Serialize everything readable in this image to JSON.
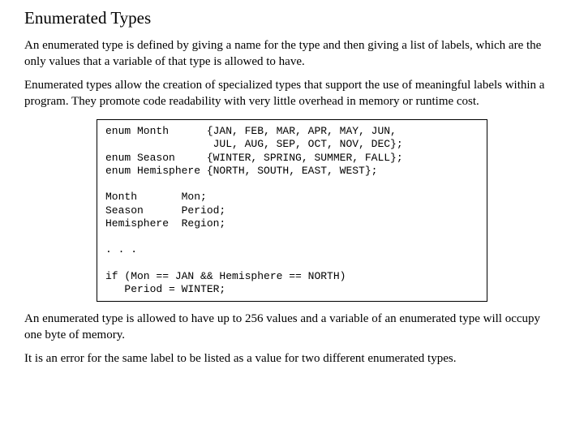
{
  "title": "Enumerated Types",
  "para1": "An enumerated type is defined by giving a name for the type and then giving a list of labels, which are the only values that a variable of that type is allowed to have.",
  "para2": "Enumerated types allow the creation of specialized types that support the use of meaningful labels within a program.  They promote code readability with very little overhead in memory or runtime cost.",
  "code": "enum Month      {JAN, FEB, MAR, APR, MAY, JUN,\n                 JUL, AUG, SEP, OCT, NOV, DEC};\nenum Season     {WINTER, SPRING, SUMMER, FALL};\nenum Hemisphere {NORTH, SOUTH, EAST, WEST};\n\nMonth       Mon;\nSeason      Period;\nHemisphere  Region;\n\n. . .\n\nif (Mon == JAN && Hemisphere == NORTH)\n   Period = WINTER;",
  "para3": "An enumerated type is allowed to have up to 256 values and a variable of an enumerated type will occupy one byte of memory.",
  "para4": "It is an error for the same label to be listed as a value for two different enumerated types."
}
